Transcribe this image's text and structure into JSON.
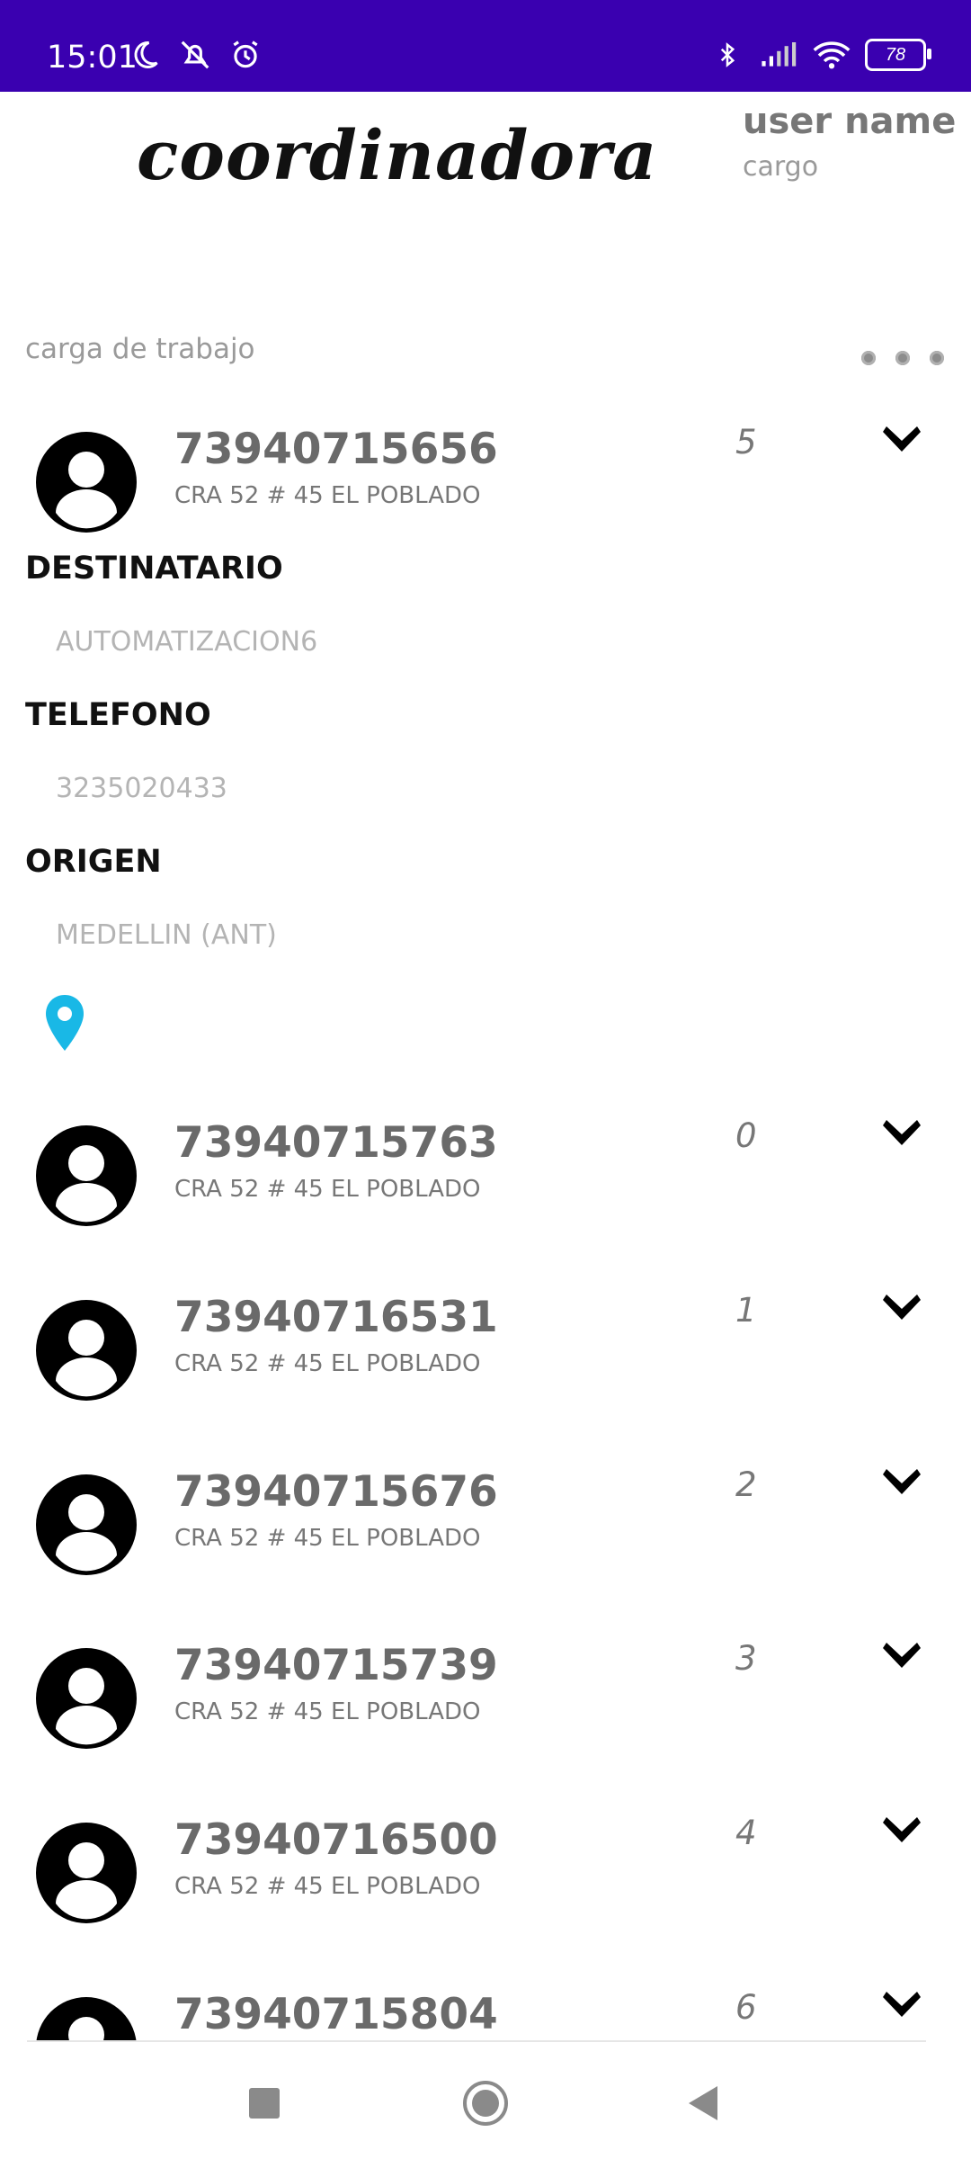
{
  "status_bar": {
    "time": "15:01",
    "battery": "78",
    "icons": [
      "moon-icon",
      "mute-icon",
      "alarm-icon",
      "bluetooth-icon",
      "signal-icon",
      "wifi-icon",
      "battery-icon"
    ]
  },
  "header": {
    "logo": "coordinadora",
    "user_name": "user name",
    "user_role": "cargo"
  },
  "workload": {
    "title": "carga de trabajo",
    "menu_icon": "more-dots-icon"
  },
  "expanded": {
    "guide": "73940715656",
    "address": "CRA 52 # 45 EL POBLADO",
    "count": "5",
    "destinatario_label": "DESTINATARIO",
    "destinatario_value": "AUTOMATIZACION6",
    "telefono_label": "TELEFONO",
    "telefono_value": "3235020433",
    "origen_label": "ORIGEN",
    "origen_value": "MEDELLIN (ANT)",
    "location_icon": "location-pin-icon"
  },
  "items": [
    {
      "guide": "73940715763",
      "address": "CRA 52 # 45 EL POBLADO",
      "count": "0"
    },
    {
      "guide": "73940716531",
      "address": "CRA 52 # 45 EL POBLADO",
      "count": "1"
    },
    {
      "guide": "73940715676",
      "address": "CRA 52 # 45 EL POBLADO",
      "count": "2"
    },
    {
      "guide": "73940715739",
      "address": "CRA 52 # 45 EL POBLADO",
      "count": "3"
    },
    {
      "guide": "73940716500",
      "address": "CRA 52 # 45 EL POBLADO",
      "count": "4"
    },
    {
      "guide": "73940715804",
      "address": "",
      "count": "6"
    }
  ],
  "colors": {
    "status_bar": "#3a00b0",
    "pin": "#19b8e6"
  },
  "navbar": {
    "buttons": [
      "recent-apps-icon",
      "home-icon",
      "back-icon"
    ]
  }
}
